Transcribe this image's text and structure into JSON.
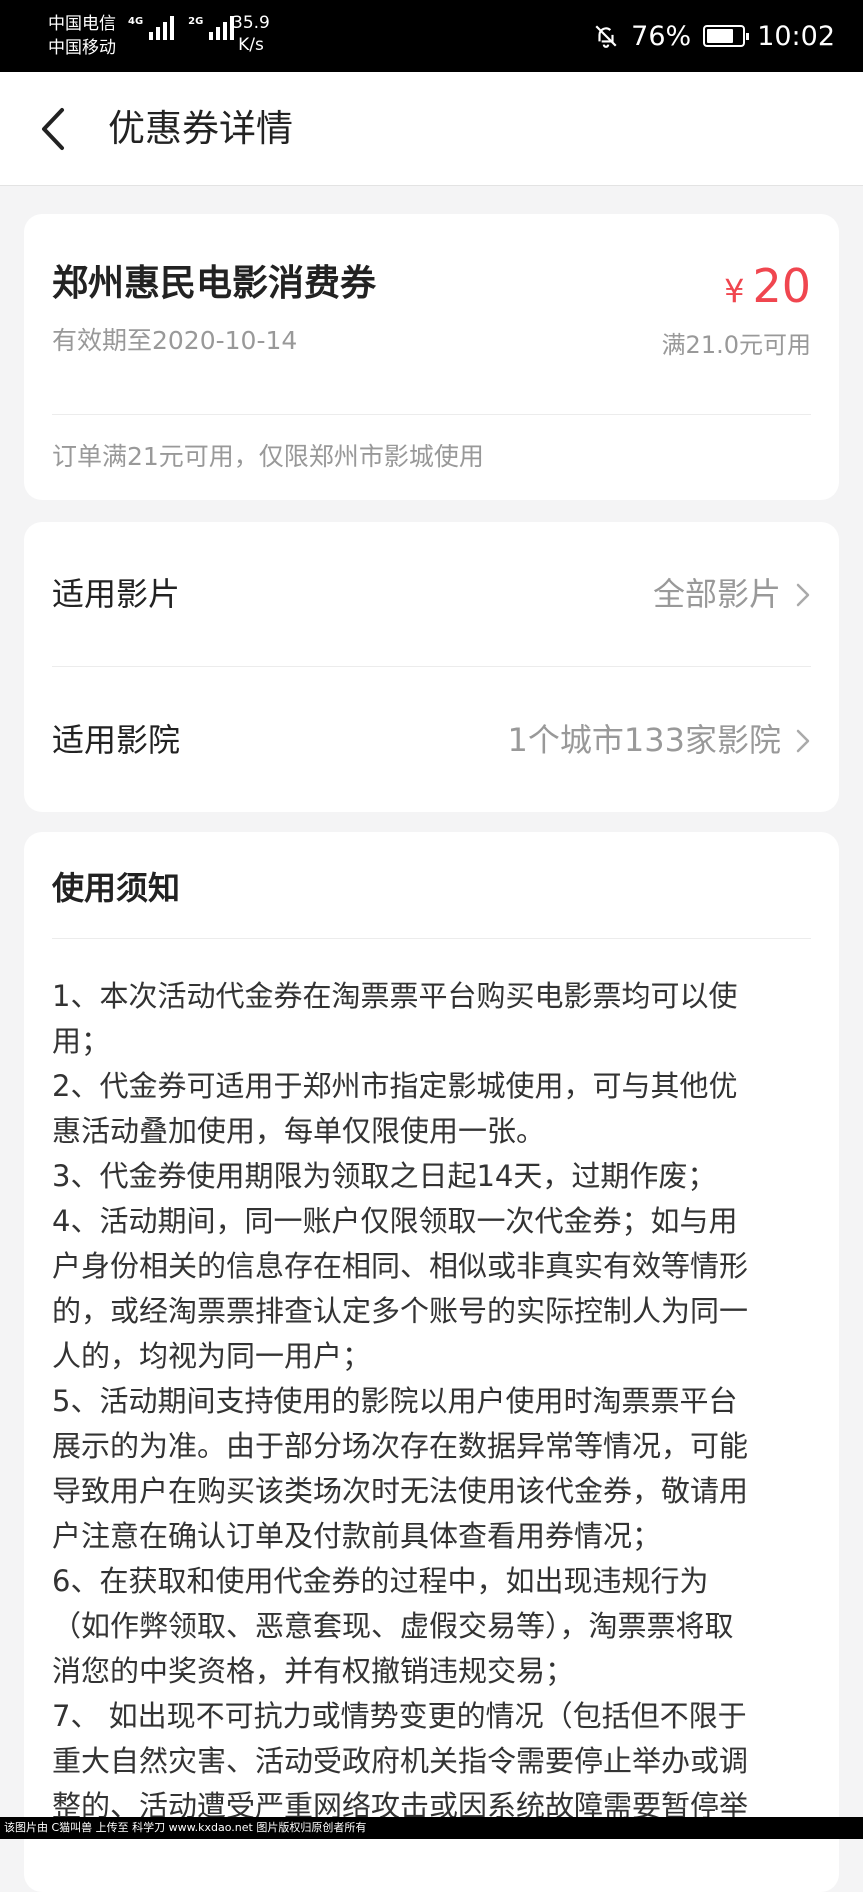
{
  "status_bar": {
    "carrier1": "中国电信",
    "carrier2": "中国移动",
    "sig1_tag": "4G",
    "sig2_tag": "2G",
    "speed_value": "35.9",
    "speed_unit": "K/s",
    "battery": "76%",
    "battery_level": 0.76,
    "time": "10:02"
  },
  "header": {
    "title": "优惠券详情"
  },
  "coupon": {
    "name": "郑州惠民电影消费券",
    "validity": "有效期至2020-10-14",
    "currency": "¥",
    "amount": "20",
    "condition": "满21.0元可用",
    "note": "订单满21元可用，仅限郑州市影城使用"
  },
  "applicability": {
    "films_label": "适用影片",
    "films_value": "全部影片",
    "cinemas_label": "适用影院",
    "cinemas_value": "1个城市133家影院"
  },
  "notice": {
    "title": "使用须知",
    "lines": [
      "1、本次活动代金券在淘票票平台购买电影票均可以使",
      "用；",
      "2、代金券可适用于郑州市指定影城使用，可与其他优",
      "惠活动叠加使用，每单仅限使用一张。",
      "3、代金券使用期限为领取之日起14天，过期作废；",
      "4、活动期间，同一账户仅限领取一次代金券；如与用",
      "户身份相关的信息存在相同、相似或非真实有效等情形",
      "的，或经淘票票排查认定多个账号的实际控制人为同一",
      "人的，均视为同一用户；",
      "5、活动期间支持使用的影院以用户使用时淘票票平台",
      "展示的为准。由于部分场次存在数据异常等情况，可能",
      "导致用户在购买该类场次时无法使用该代金券，敬请用",
      "户注意在确认订单及付款前具体查看用券情况；",
      "6、在获取和使用代金券的过程中，如出现违规行为",
      "（如作弊领取、恶意套现、虚假交易等），淘票票将取",
      "消您的中奖资格，并有权撤销违规交易；",
      "7、 如出现不可抗力或情势变更的情况（包括但不限于",
      "重大自然灾害、活动受政府机关指令需要停止举办或调",
      "整的、活动遭受严重网络攻击或因系统故障需要暂停举"
    ]
  },
  "watermark": "该图片由 C猫叫兽 上传至 科学刀 www.kxdao.net 图片版权归原创者所有"
}
